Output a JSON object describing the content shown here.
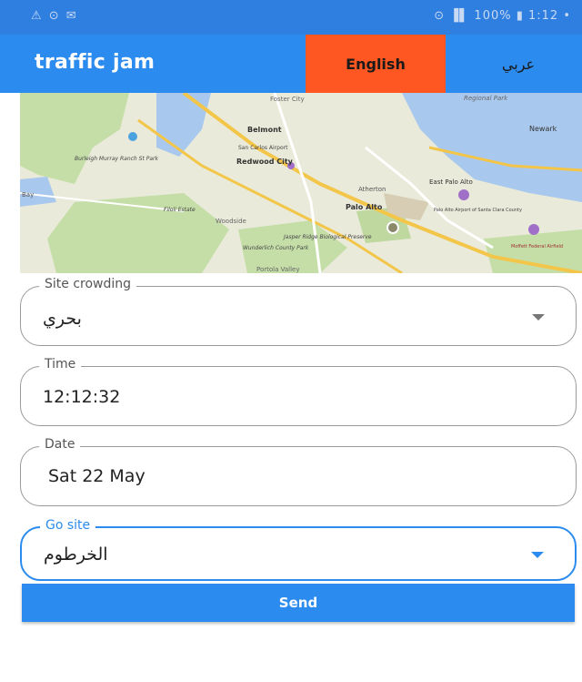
{
  "status_bar": {
    "left": "⚠ ⊙ ✉",
    "right": "⊙ ▐▌ 100% ▮ 1:12 •"
  },
  "app_bar": {
    "title": "traffic jam",
    "lang_english": "English",
    "lang_arabic": "عربي"
  },
  "map": {
    "labels": [
      "Foster City",
      "Regional Park",
      "Belmont",
      "Newark",
      "San Carlos Airport",
      "Redwood City",
      "East Palo Alto",
      "Atherton",
      "Palo Alto",
      "Palo Alto Airport of Santa Clara County",
      "Burleigh Murray Ranch St Park",
      "Filoli Estate",
      "Woodside",
      "Jasper Ridge Biological Preserve",
      "Wunderlich County Park",
      "Moffett Federal Airfield",
      "Portola Valley",
      "Bay"
    ]
  },
  "form": {
    "site_crowding": {
      "label": "Site crowding",
      "value": "بحري"
    },
    "time": {
      "label": "Time",
      "value": "12:12:32"
    },
    "date": {
      "label": "Date",
      "value": "Sat 22 May"
    },
    "go_site": {
      "label": "Go site",
      "value": "الخرطوم"
    },
    "send_label": "Send"
  },
  "colors": {
    "primary": "#2b8bee",
    "accent": "#ff5722",
    "statusbar": "#2f7fe0"
  }
}
